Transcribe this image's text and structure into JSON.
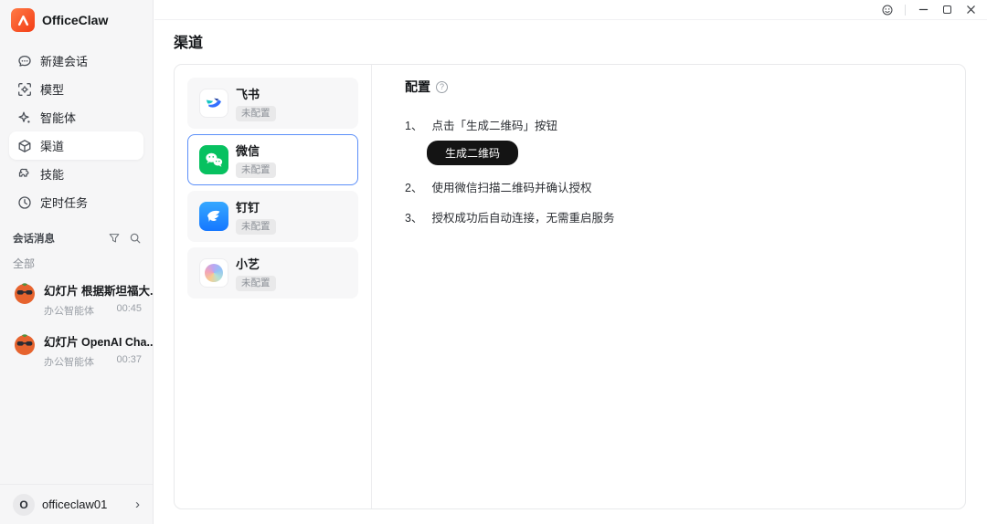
{
  "app": {
    "name": "OfficeClaw"
  },
  "colors": {
    "accent": "#f3431a",
    "selected_border": "#5b8ff9",
    "wechat_green": "#07c160",
    "dingtalk_blue": "#1e90ff",
    "feishu_blue": "#3370ff",
    "button_black": "#141414"
  },
  "icons": {
    "help_glyph": "?",
    "chevron_glyph": "›"
  },
  "sidebar": {
    "nav": [
      {
        "label": "新建会话"
      },
      {
        "label": "模型"
      },
      {
        "label": "智能体"
      },
      {
        "label": "渠道",
        "active": true
      },
      {
        "label": "技能"
      },
      {
        "label": "定时任务"
      }
    ],
    "messages": {
      "header": "会话消息",
      "filter_all": "全部",
      "conversations": [
        {
          "title": "幻灯片 根据斯坦福大...",
          "subtitle": "办公智能体",
          "time": "00:45"
        },
        {
          "title": "幻灯片 OpenAI Cha...",
          "subtitle": "办公智能体",
          "time": "00:37"
        }
      ]
    },
    "account": {
      "initial": "O",
      "name": "officeclaw01"
    }
  },
  "main": {
    "page_title": "渠道",
    "channels": [
      {
        "name": "飞书",
        "status": "未配置"
      },
      {
        "name": "微信",
        "status": "未配置",
        "selected": true
      },
      {
        "name": "钉钉",
        "status": "未配置"
      },
      {
        "name": "小艺",
        "status": "未配置"
      }
    ],
    "config": {
      "title": "配置",
      "steps": [
        {
          "num": "1、",
          "text": "点击「生成二维码」按钮"
        },
        {
          "num": "2、",
          "text": "使用微信扫描二维码并确认授权"
        },
        {
          "num": "3、",
          "text": "授权成功后自动连接，无需重启服务"
        }
      ],
      "qr_button": "生成二维码"
    }
  }
}
